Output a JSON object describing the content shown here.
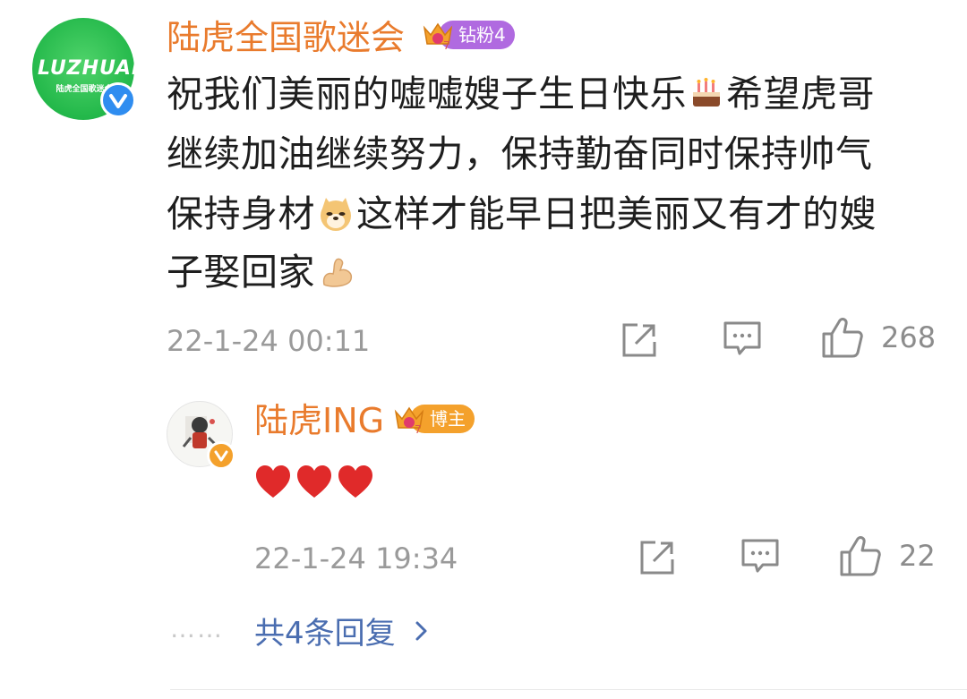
{
  "main_comment": {
    "username": "陆虎全国歌迷会",
    "avatar_logo_text": "LUZHUANG",
    "avatar_logo_sub": "陆虎全国歌迷会",
    "badge_label": "钻粉4",
    "badge_level": "7",
    "text_lines": [
      "祝我们美丽的嘘嘘嫂子生日快乐",
      "希望虎哥",
      "继续加油继续努力，保持勤奋同时保持帅气",
      "保持身材",
      "这样才能早日把美丽又有才的嫂",
      "子娶回家"
    ],
    "timestamp": "22-1-24 00:11",
    "like_count": "268"
  },
  "reply": {
    "username": "陆虎ING",
    "badge_label": "博主",
    "badge_level": "7",
    "timestamp": "22-1-24 19:34",
    "like_count": "22"
  },
  "footer": {
    "dots": "……",
    "more_replies": "共4条回复"
  },
  "icons": {
    "share": "share-icon",
    "comment": "comment-icon",
    "like": "like-icon",
    "cake": "cake-emoji",
    "doge": "doge-emoji",
    "muscle": "muscle-emoji",
    "heart": "heart-emoji"
  },
  "colors": {
    "username": "#e97b2d",
    "link": "#4a6db0",
    "time": "#9a9a9a",
    "badge_purple": "#b06ae0",
    "badge_orange": "#f4a12c",
    "heart": "#e02a2a"
  }
}
